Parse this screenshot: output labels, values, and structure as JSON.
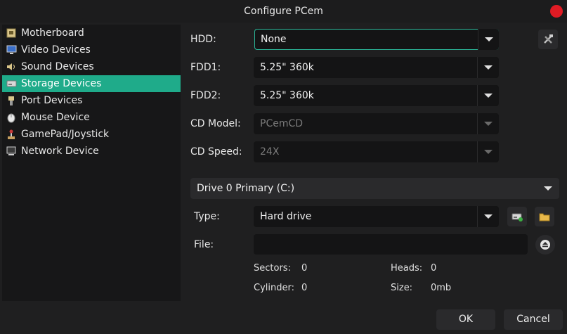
{
  "window": {
    "title": "Configure PCem"
  },
  "sidebar": {
    "items": [
      {
        "label": "Motherboard",
        "icon": "motherboard-icon"
      },
      {
        "label": "Video Devices",
        "icon": "monitor-icon"
      },
      {
        "label": "Sound Devices",
        "icon": "speaker-icon"
      },
      {
        "label": "Storage Devices",
        "icon": "drive-icon",
        "selected": true
      },
      {
        "label": "Port Devices",
        "icon": "plug-icon"
      },
      {
        "label": "Mouse Device",
        "icon": "mouse-icon"
      },
      {
        "label": "GamePad/Joystick",
        "icon": "joystick-icon"
      },
      {
        "label": "Network Device",
        "icon": "network-icon"
      }
    ]
  },
  "storage": {
    "hdd_label": "HDD:",
    "hdd_value": "None",
    "fdd1_label": "FDD1:",
    "fdd1_value": "5.25\" 360k",
    "fdd2_label": "FDD2:",
    "fdd2_value": "5.25\" 360k",
    "cd_model_label": "CD Model:",
    "cd_model_value": "PCemCD",
    "cd_speed_label": "CD Speed:",
    "cd_speed_value": "24X",
    "drive_select_value": "Drive 0 Primary (C:)",
    "type_label": "Type:",
    "type_value": "Hard drive",
    "file_label": "File:",
    "file_value": "",
    "sectors_label": "Sectors:",
    "sectors_value": "0",
    "heads_label": "Heads:",
    "heads_value": "0",
    "cylinder_label": "Cylinder:",
    "cylinder_value": "0",
    "size_label": "Size:",
    "size_value": "0mb"
  },
  "actions": {
    "ok_label": "OK",
    "cancel_label": "Cancel"
  },
  "colors": {
    "accent": "#1fab8a",
    "close": "#e01b24",
    "background": "#1f1f20"
  }
}
